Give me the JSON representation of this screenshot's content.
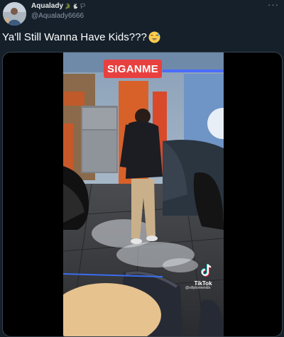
{
  "author": {
    "display_name": "Aqualady",
    "name_emojis": "🐊 🐇 🏳",
    "handle": "@Aqualady6666"
  },
  "tweet": {
    "text": "Ya'll Still Wanna Have Kids???",
    "emoji": "grinning-sweat-emoji"
  },
  "more_icon": "more-options-icon",
  "video": {
    "caption": "SIGANME",
    "watermark": "TikTok",
    "watermark_handle": "@sillybomenido"
  },
  "colors": {
    "background": "#15202b",
    "caption_bg": "#e8403f",
    "handle": "#8b98a5"
  }
}
